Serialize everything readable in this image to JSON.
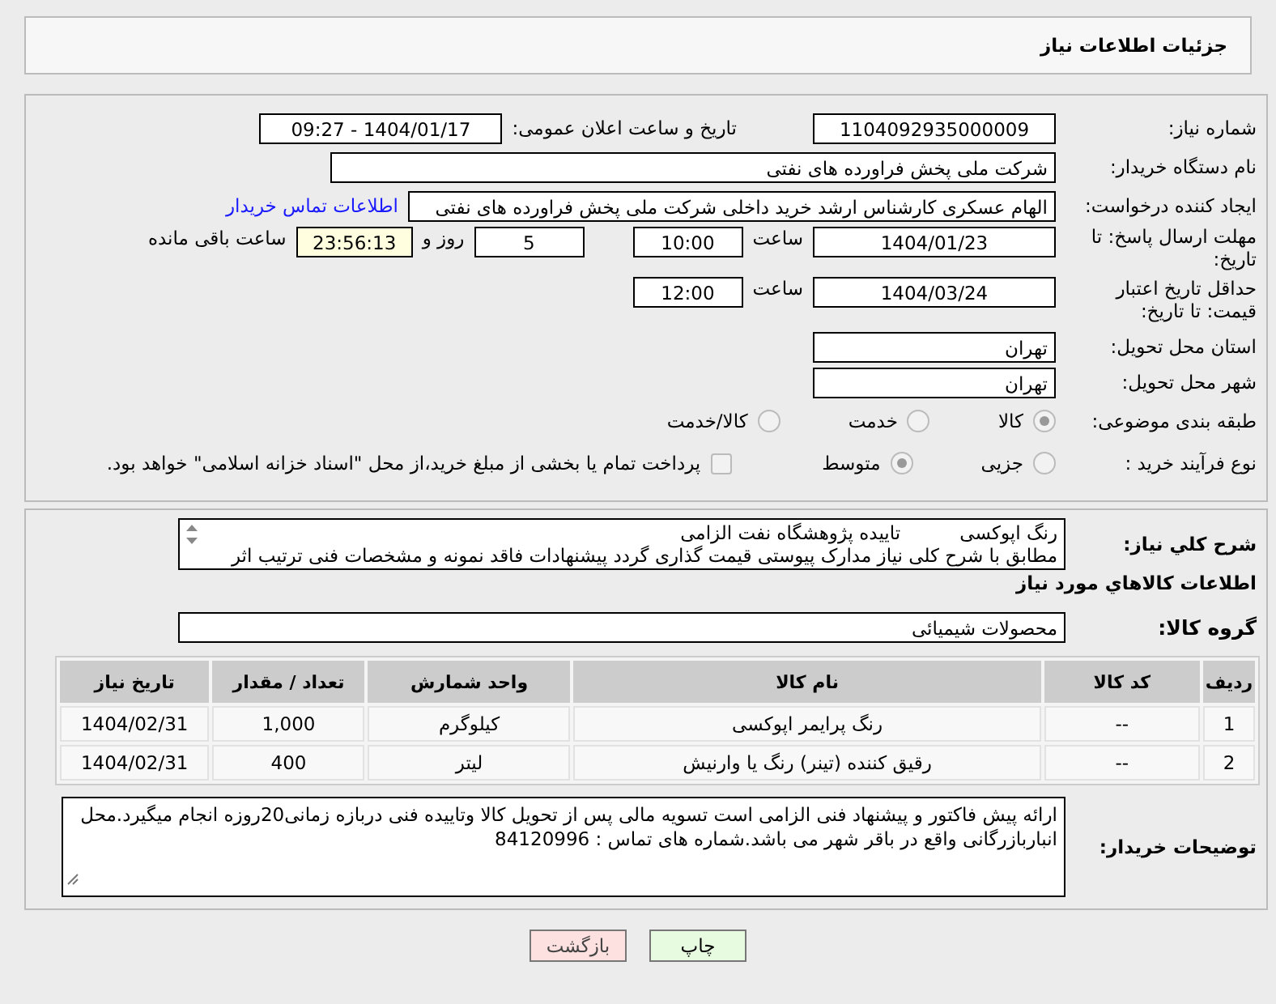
{
  "title": "جزئیات اطلاعات نیاز",
  "need_number": {
    "label": "شماره نیاز:",
    "value": "1104092935000009"
  },
  "announce": {
    "label": "تاریخ و ساعت اعلان عمومی:",
    "value": "1404/01/17 - 09:27"
  },
  "buyer": {
    "label": "نام دستگاه خریدار:",
    "value": "شرکت ملی پخش فراورده های نفتی"
  },
  "requester": {
    "label": "ایجاد کننده درخواست:",
    "value": "الهام عسکری کارشناس ارشد خرید داخلی شرکت ملی پخش فراورده های نفتی",
    "link": "اطلاعات تماس خریدار"
  },
  "deadline": {
    "label": "مهلت ارسال پاسخ: تا تاریخ:",
    "date": "1404/01/23",
    "time_label": "ساعت",
    "time": "10:00",
    "days": "5",
    "days_label": "روز و",
    "remaining": "23:56:13",
    "remaining_label": "ساعت باقی مانده"
  },
  "validity": {
    "label": "حداقل تاریخ اعتبار قیمت: تا تاریخ:",
    "date": "1404/03/24",
    "time_label": "ساعت",
    "time": "12:00"
  },
  "province": {
    "label": "استان محل تحویل:",
    "value": "تهران"
  },
  "city": {
    "label": "شهر محل تحویل:",
    "value": "تهران"
  },
  "category": {
    "label": "طبقه بندی موضوعی:",
    "options": [
      {
        "label": "کالا",
        "selected": true
      },
      {
        "label": "خدمت",
        "selected": false
      },
      {
        "label": "کالا/خدمت",
        "selected": false
      }
    ]
  },
  "process": {
    "label": "نوع فرآیند خرید :",
    "options": [
      {
        "label": "جزیی",
        "selected": false
      },
      {
        "label": "متوسط",
        "selected": true
      }
    ],
    "payment": {
      "label": "پرداخت تمام یا بخشی از مبلغ خرید،از محل \"اسناد خزانه اسلامی\" خواهد بود.",
      "checked": false
    }
  },
  "description": {
    "label": "شرح کلي نياز:",
    "value": "رنگ اپوکسی          تاییده پژوهشگاه نفت الزامی\nمطابق با شرح کلی نیاز مدارک پیوستی قیمت گذاری گردد پیشنهادات فاقد نمونه و مشخصات فنی ترتیب اثر"
  },
  "goods_heading": "اطلاعات کالاهاي مورد نياز",
  "goods_group": {
    "label": "گروه کالا:",
    "value": "محصولات شیمیائی"
  },
  "table": {
    "columns": [
      "ردیف",
      "کد کالا",
      "نام کالا",
      "واحد شمارش",
      "تعداد / مقدار",
      "تاریخ نیاز"
    ],
    "rows": [
      [
        "1",
        "--",
        "رنگ پرایمر اپوکسی",
        "کیلوگرم",
        "1,000",
        "1404/02/31"
      ],
      [
        "2",
        "--",
        "رقیق کننده (تینر) رنگ یا وارنیش",
        "لیتر",
        "400",
        "1404/02/31"
      ]
    ]
  },
  "buyer_notes": {
    "label": "توضیحات خریدار:",
    "value": "ارائه پیش فاکتور و پیشنهاد فنی الزامی است تسویه مالی پس از تحویل کالا وتاییده فنی دربازه زمانی20روزه انجام میگیرد.محل انباربازرگانی واقع در باقر شهر می باشد.شماره های تماس : 84120996"
  },
  "buttons": [
    {
      "label": "چاپ",
      "kind": "print"
    },
    {
      "label": "بازگشت",
      "kind": "back"
    }
  ]
}
